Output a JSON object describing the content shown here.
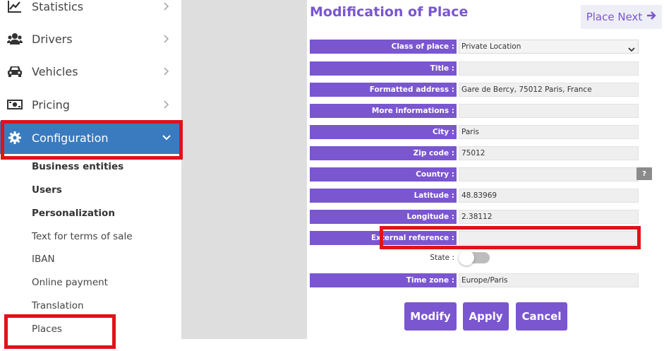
{
  "sidebar": {
    "items": [
      {
        "label": "Statistics",
        "icon": "chart-line-icon"
      },
      {
        "label": "Drivers",
        "icon": "users-icon"
      },
      {
        "label": "Vehicles",
        "icon": "car-icon"
      },
      {
        "label": "Pricing",
        "icon": "money-bill-icon"
      },
      {
        "label": "Configuration",
        "icon": "gear-icon",
        "active": true
      }
    ],
    "sub_items": [
      {
        "label": "Business entities",
        "bold": true
      },
      {
        "label": "Users",
        "bold": true
      },
      {
        "label": "Personalization",
        "bold": true
      },
      {
        "label": "Text for terms of sale",
        "bold": false
      },
      {
        "label": "IBAN",
        "bold": false
      },
      {
        "label": "Online payment",
        "bold": false
      },
      {
        "label": "Translation",
        "bold": false
      },
      {
        "label": "Places",
        "bold": false
      }
    ]
  },
  "main": {
    "title": "Modification of Place",
    "next_label": "Place Next",
    "fields": [
      {
        "label": "Class of place :",
        "value": "Private Location",
        "type": "select"
      },
      {
        "label": "Title :",
        "value": ""
      },
      {
        "label": "Formatted address :",
        "value": "Gare de Bercy, 75012 Paris, France"
      },
      {
        "label": "More informations :",
        "value": ""
      },
      {
        "label": "City :",
        "value": "Paris"
      },
      {
        "label": "Zip code :",
        "value": "75012"
      },
      {
        "label": "Country :",
        "value": "",
        "help": "?"
      },
      {
        "label": "Latitude :",
        "value": "48.83969"
      },
      {
        "label": "Longitude :",
        "value": "2.38112"
      },
      {
        "label": "External reference :",
        "value": ""
      }
    ],
    "state_label": "State :",
    "state_on": false,
    "timezone": {
      "label": "Time zone :",
      "value": "Europe/Paris"
    },
    "buttons": {
      "modify": "Modify",
      "apply": "Apply",
      "cancel": "Cancel"
    }
  },
  "colors": {
    "accent": "#7a56d0",
    "active_nav": "#3a7bbf",
    "highlight": "#e0121a"
  }
}
